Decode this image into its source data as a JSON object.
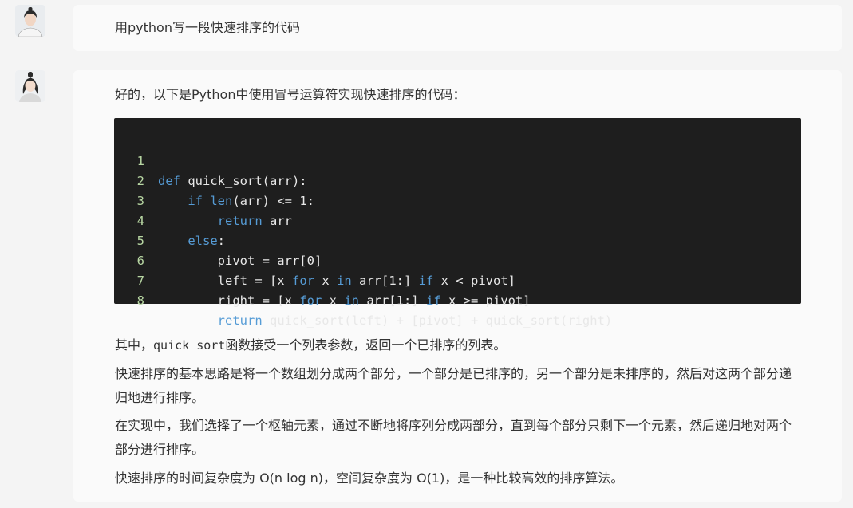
{
  "conversation": {
    "user_message": {
      "avatar": "male-user-avatar",
      "text": "用python写一段快速排序的代码"
    },
    "assistant_message": {
      "avatar": "female-assistant-avatar",
      "intro": "好的，以下是Python中使用冒号运算符实现快速排序的代码：",
      "code": {
        "language": "python",
        "lines": [
          {
            "num": "1",
            "text": "def quick_sort(arr):"
          },
          {
            "num": "2",
            "text": "    if len(arr) <= 1:"
          },
          {
            "num": "3",
            "text": "        return arr"
          },
          {
            "num": "4",
            "text": "    else:"
          },
          {
            "num": "5",
            "text": "        pivot = arr[0]"
          },
          {
            "num": "6",
            "text": "        left = [x for x in arr[1:] if x < pivot]"
          },
          {
            "num": "7",
            "text": "        right = [x for x in arr[1:] if x >= pivot]"
          },
          {
            "num": "8",
            "text": "        return quick_sort(left) + [pivot] + quick_sort(right)"
          }
        ]
      },
      "para1_before": "其中，",
      "para1_code": "quick_sort",
      "para1_after": "函数接受一个列表参数，返回一个已排序的列表。",
      "para2": "快速排序的基本思路是将一个数组划分成两个部分，一个部分是已排序的，另一个部分是未排序的，然后对这两个部分递归地进行排序。",
      "para3": "在实现中，我们选择了一个枢轴元素，通过不断地将序列分成两部分，直到每个部分只剩下一个元素，然后递归地对两个部分进行排序。",
      "para4": "快速排序的时间复杂度为 O(n log n)，空间复杂度为 O(1)，是一种比较高效的排序算法。"
    }
  },
  "colors": {
    "background": "#f4f4f4",
    "bubble": "#fafafa",
    "code_background": "#1e1e1e",
    "keyword": "#569cd6",
    "line_number": "#b8d7a3"
  }
}
